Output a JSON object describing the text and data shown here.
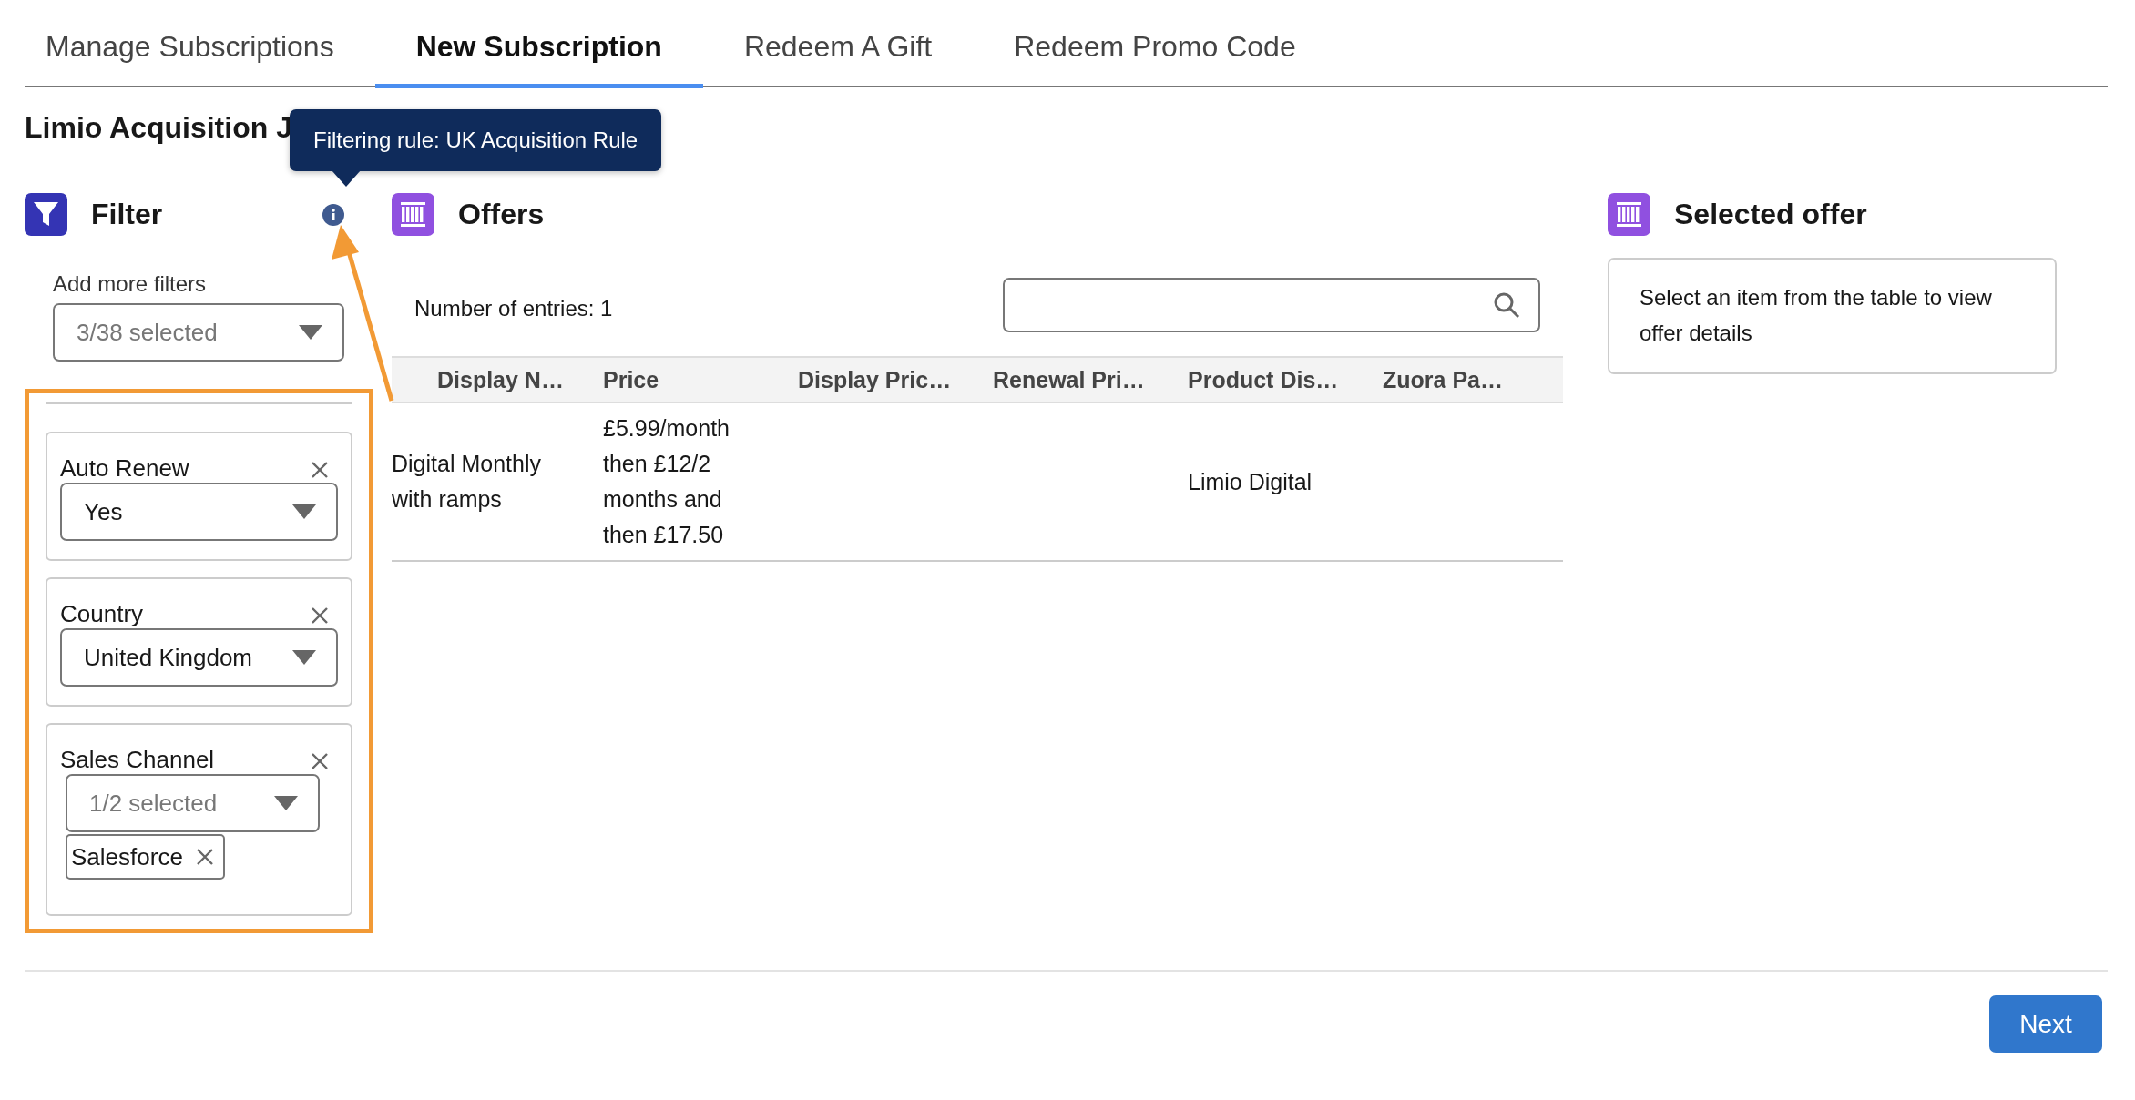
{
  "tabs": [
    {
      "label": "Manage Subscriptions",
      "selected": false
    },
    {
      "label": "New Subscription",
      "selected": true
    },
    {
      "label": "Redeem A Gift",
      "selected": false
    },
    {
      "label": "Redeem Promo Code",
      "selected": false
    }
  ],
  "page_title": "Limio Acquisition J",
  "tooltip": {
    "text": "Filtering rule: UK Acquisition Rule"
  },
  "filter": {
    "title": "Filter",
    "add_more": {
      "label": "Add more filters",
      "value": "3/38 selected"
    },
    "items": [
      {
        "kind": "select",
        "label": "Auto Renew",
        "value": "Yes"
      },
      {
        "kind": "select",
        "label": "Country",
        "value": "United Kingdom"
      },
      {
        "kind": "multiselect",
        "label": "Sales Channel",
        "value": "1/2 selected",
        "pills": [
          "Salesforce"
        ]
      }
    ]
  },
  "offers": {
    "title": "Offers",
    "entries": "Number of entries: 1",
    "table": {
      "columns": [
        {
          "label": "Display N…"
        },
        {
          "label": "Price"
        },
        {
          "label": "Display Pric…"
        },
        {
          "label": "Renewal Pri…"
        },
        {
          "label": "Product Dis…"
        },
        {
          "label": "Zuora Pa…"
        }
      ],
      "rows": [
        {
          "cells": [
            {
              "text": "Digital Monthly with ramps"
            },
            {
              "text": "£5.99/month then £12/2 months and then £17.50"
            },
            {},
            {},
            {
              "text": "Limio Digital"
            },
            {}
          ]
        }
      ]
    }
  },
  "selected_offer": {
    "title": "Selected offer",
    "message": "Select an item from the table to view offer details"
  },
  "footer": {
    "next": "Next"
  }
}
